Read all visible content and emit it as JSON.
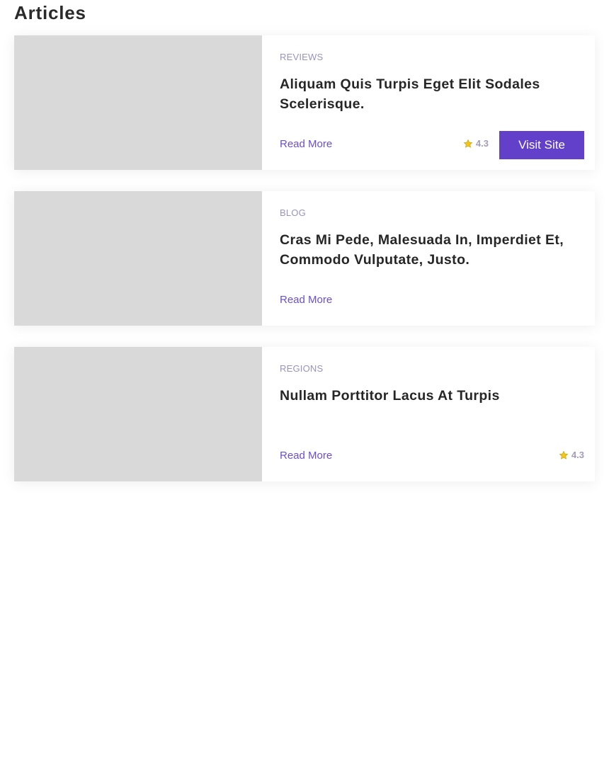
{
  "header": {
    "title": "Articles"
  },
  "articles": [
    {
      "category": "REVIEWS",
      "title": "Aliquam Quis Turpis Eget Elit Sodales Scelerisque.",
      "read_more": "Read More",
      "rating": "4.3",
      "button": "Visit Site"
    },
    {
      "category": "BLOG",
      "title": "Cras Mi Pede, Malesuada In, Imperdiet Et, Commodo Vulputate, Justo.",
      "read_more": "Read More"
    },
    {
      "category": "REGIONS",
      "title": "Nullam Porttitor Lacus At Turpis",
      "read_more": "Read More",
      "rating": "4.3"
    }
  ],
  "icons": {
    "rating": "star-icon"
  },
  "colors": {
    "accent": "#6240c9",
    "link": "#6a4fd0",
    "category": "#9a93c0",
    "image_placeholder": "#d9d9d9",
    "star": "#f5c518"
  }
}
